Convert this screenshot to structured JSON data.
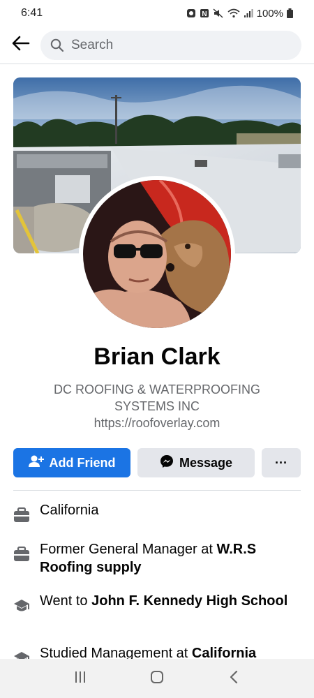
{
  "status": {
    "time": "6:41",
    "battery": "100%"
  },
  "search": {
    "placeholder": "Search"
  },
  "profile": {
    "name": "Brian Clark",
    "bio_line1": "DC ROOFING & WATERPROOFING",
    "bio_line2": "SYSTEMS INC",
    "website": "https://roofoverlay.com"
  },
  "actions": {
    "add_friend": "Add Friend",
    "message": "Message",
    "more": "···"
  },
  "details": [
    {
      "icon": "briefcase-icon",
      "prefix": "California",
      "bold": ""
    },
    {
      "icon": "briefcase-icon",
      "prefix": "Former General Manager at ",
      "bold": "W.R.S Roofing supply"
    },
    {
      "icon": "graduation-cap-icon",
      "prefix": "Went to ",
      "bold": "John F. Kennedy High School"
    },
    {
      "icon": "graduation-cap-icon",
      "prefix": "Studied Management at ",
      "bold": "California"
    }
  ],
  "colors": {
    "primary": "#1b74e4",
    "secondary_bg": "#e4e6eb",
    "muted_text": "#65676b"
  }
}
